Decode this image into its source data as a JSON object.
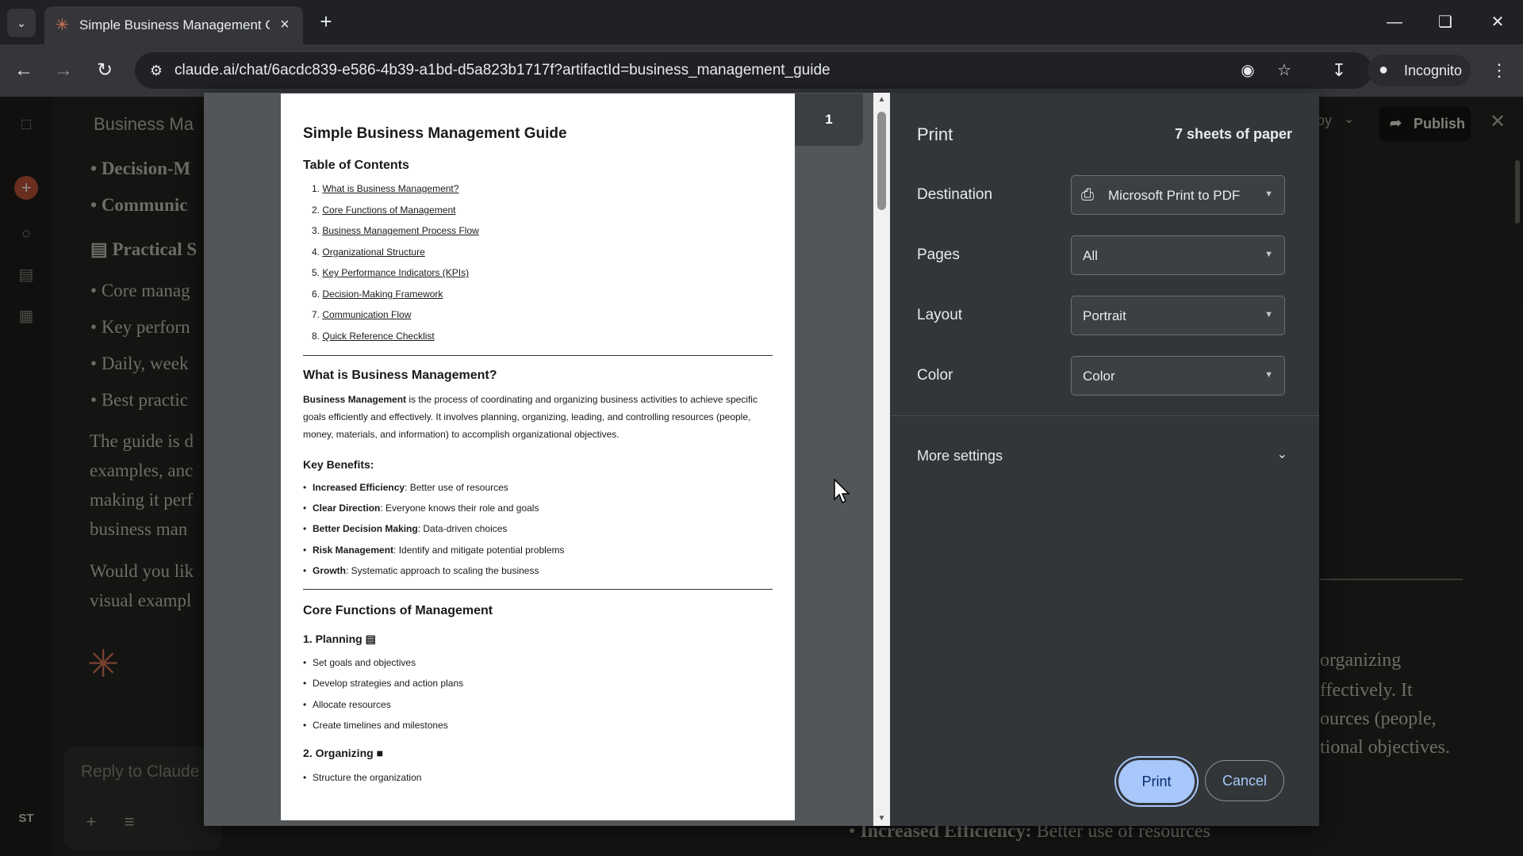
{
  "browser": {
    "tab_title": "Simple Business Management G",
    "url": "claude.ai/chat/6acdc839-e586-4b39-a1bd-d5a823b1717f?artifactId=business_management_guide",
    "incognito_label": "Incognito"
  },
  "chat": {
    "title": "Business Ma",
    "items": [
      "Decision-M",
      "Communic"
    ],
    "section_heading": "Practical S",
    "bullets": [
      "Core manag",
      "Key perforn",
      "Daily, week",
      "Best practic"
    ],
    "para1": [
      "The guide is d",
      "examples, anc",
      "making it perf",
      "business man"
    ],
    "para2": [
      "Would you lik",
      "visual exampl"
    ],
    "reply_placeholder": "Reply to Claude",
    "avatar_initials": "ST"
  },
  "artifact": {
    "copy_fragment": "oy",
    "publish_label": "Publish",
    "text_lines": [
      "organizing",
      "ffectively. It",
      "ources (people,",
      "tional objectives."
    ],
    "bottom_bold": "Increased Efficiency:",
    "bottom_rest": " Better use of resources"
  },
  "print_dialog": {
    "title": "Print",
    "sheets": "7 sheets of paper",
    "page_indicator": "1",
    "destination": {
      "label": "Destination",
      "value": "Microsoft Print to PDF"
    },
    "pages": {
      "label": "Pages",
      "value": "All"
    },
    "layout": {
      "label": "Layout",
      "value": "Portrait"
    },
    "color": {
      "label": "Color",
      "value": "Color"
    },
    "more_settings": "More settings",
    "print_button": "Print",
    "cancel_button": "Cancel"
  },
  "document": {
    "title": "Simple Business Management Guide",
    "toc_heading": "Table of Contents",
    "toc": [
      {
        "num": "1.",
        "text": "What is Business Management?"
      },
      {
        "num": "2.",
        "text": "Core Functions of Management"
      },
      {
        "num": "3.",
        "text": "Business Management Process Flow"
      },
      {
        "num": "4.",
        "text": "Organizational Structure"
      },
      {
        "num": "5.",
        "text": "Key Performance Indicators (KPIs)"
      },
      {
        "num": "6.",
        "text": "Decision-Making Framework"
      },
      {
        "num": "7.",
        "text": "Communication Flow"
      },
      {
        "num": "8.",
        "text": "Quick Reference Checklist"
      }
    ],
    "what_heading": "What is Business Management?",
    "what_bold": "Business Management",
    "what_text": " is the process of coordinating and organizing business activities to achieve specific goals efficiently and effectively. It involves planning, organizing, leading, and controlling resources (people, money, materials, and information) to accomplish organizational objectives.",
    "benefits_heading": "Key Benefits:",
    "benefits": [
      {
        "bold": "Increased Efficiency",
        "text": ": Better use of resources"
      },
      {
        "bold": "Clear Direction",
        "text": ": Everyone knows their role and goals"
      },
      {
        "bold": "Better Decision Making",
        "text": ": Data-driven choices"
      },
      {
        "bold": "Risk Management",
        "text": ": Identify and mitigate potential problems"
      },
      {
        "bold": "Growth",
        "text": ": Systematic approach to scaling the business"
      }
    ],
    "core_heading": "Core Functions of Management",
    "planning_heading": "1. Planning",
    "planning_items": [
      "Set goals and objectives",
      "Develop strategies and action plans",
      "Allocate resources",
      "Create timelines and milestones"
    ],
    "organizing_heading": "2. Organizing",
    "organizing_items": [
      "Structure the organization"
    ]
  },
  "icons": {
    "tab_favicon": "claude-asterisk-icon",
    "printer": "printer-icon"
  }
}
